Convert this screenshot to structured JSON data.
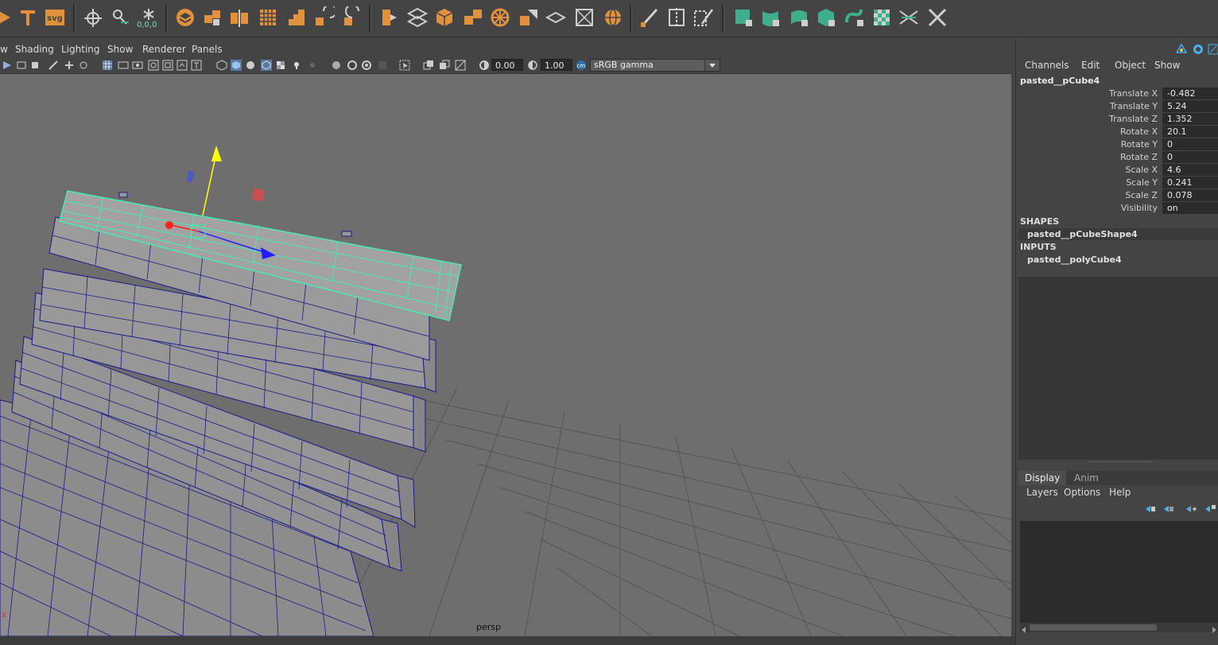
{
  "viewport_menu": [
    "w",
    "Shading",
    "Lighting",
    "Show",
    "Renderer",
    "Panels"
  ],
  "viewport_toolbar": {
    "exposure": "0.00",
    "gamma": "1.00",
    "color_space": "sRGB gamma"
  },
  "viewport_label": "persp",
  "shelf": {
    "snap_readout": "0,0,0"
  },
  "channel_box": {
    "menu": [
      "Channels",
      "Edit",
      "Object",
      "Show"
    ],
    "object_name": "pasted__pCube4",
    "attributes": [
      {
        "label": "Translate X",
        "value": "-0.482"
      },
      {
        "label": "Translate Y",
        "value": "5.24"
      },
      {
        "label": "Translate Z",
        "value": "1.352"
      },
      {
        "label": "Rotate X",
        "value": "20.1"
      },
      {
        "label": "Rotate Y",
        "value": "0"
      },
      {
        "label": "Rotate Z",
        "value": "0"
      },
      {
        "label": "Scale X",
        "value": "4.6"
      },
      {
        "label": "Scale Y",
        "value": "0.241"
      },
      {
        "label": "Scale Z",
        "value": "0.078"
      },
      {
        "label": "Visibility",
        "value": "on"
      }
    ],
    "shapes_header": "SHAPES",
    "shape_node": "pasted__pCubeShape4",
    "inputs_header": "INPUTS",
    "input_node": "pasted__polyCube4"
  },
  "layer_editor": {
    "tabs": [
      "Display",
      "Anim"
    ],
    "menu": [
      "Layers",
      "Options",
      "Help"
    ]
  },
  "colors": {
    "accent_teal": "#3fae8f",
    "accent_orange": "#e1913c",
    "selection_green": "#49e9b1",
    "wire_blue": "#1a1a8c"
  }
}
